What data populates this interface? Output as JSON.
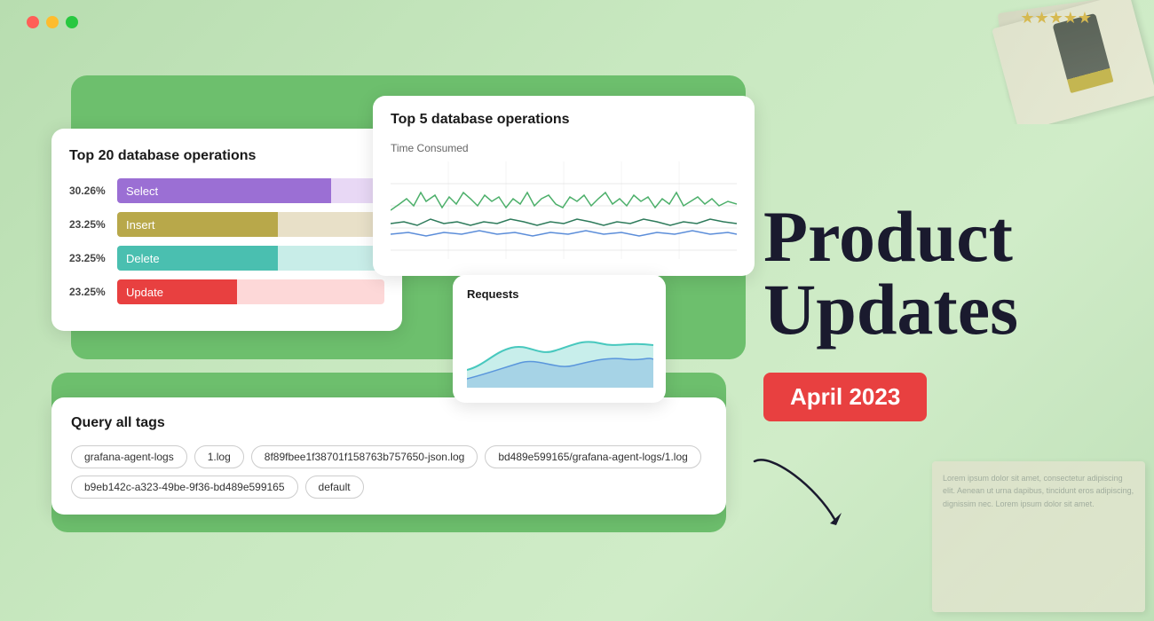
{
  "window": {
    "dots": [
      "red",
      "yellow",
      "green"
    ]
  },
  "card_top20": {
    "title": "Top 20 database operations",
    "bars": [
      {
        "pct": "30.26%",
        "label": "Select",
        "type": "select"
      },
      {
        "pct": "23.25%",
        "label": "Insert",
        "type": "insert"
      },
      {
        "pct": "23.25%",
        "label": "Delete",
        "type": "delete"
      },
      {
        "pct": "23.25%",
        "label": "Update",
        "type": "update"
      }
    ]
  },
  "card_top5": {
    "title": "Top 5 database operations",
    "subtitle": "Time Consumed"
  },
  "card_requests": {
    "title": "Requests"
  },
  "card_query": {
    "title": "Query all tags",
    "tags": [
      "grafana-agent-logs",
      "1.log",
      "8f89fbee1f38701f158763b757650-json.log",
      "bd489e599165/grafana-agent-logs/1.log",
      "b9eb142c-a323-49be-9f36-bd489e599165",
      "default"
    ]
  },
  "right_panel": {
    "title_line1": "Product",
    "title_line2": "Updates",
    "date_badge": "April 2023"
  },
  "colors": {
    "accent_red": "#e84040",
    "bg_green": "#6dbf6d",
    "dark_navy": "#1a1a2e"
  }
}
